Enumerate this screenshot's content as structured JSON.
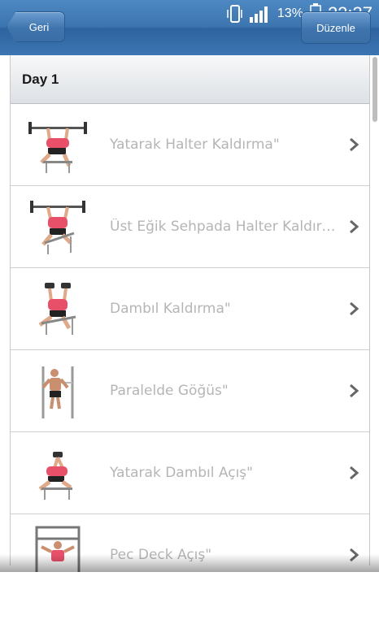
{
  "status_bar": {
    "battery_percent": "13%",
    "time": "22:37",
    "icons": [
      "vibrate-icon",
      "signal-icon",
      "battery-icon"
    ]
  },
  "nav": {
    "back_label": "Geri",
    "edit_label": "Düzenle"
  },
  "section": {
    "title": "Day 1"
  },
  "exercises": [
    {
      "label": "Yatarak Halter Kaldırma\"",
      "icon": "bench-press-icon"
    },
    {
      "label": "Üst Eğik Sehpada Halter Kaldırma\"",
      "icon": "incline-bench-press-icon"
    },
    {
      "label": "Dambıl Kaldırma\"",
      "icon": "dumbbell-press-icon"
    },
    {
      "label": "Paralelde Göğüs\"",
      "icon": "parallel-dips-icon"
    },
    {
      "label": "Yatarak Dambıl Açış\"",
      "icon": "dumbbell-fly-icon"
    },
    {
      "label": "Pec Deck Açış\"",
      "icon": "pec-deck-icon"
    }
  ],
  "colors": {
    "bar_blue": "#3c75b0",
    "label_gray": "#b5b5b5",
    "shirt_pink": "#e8506a"
  }
}
